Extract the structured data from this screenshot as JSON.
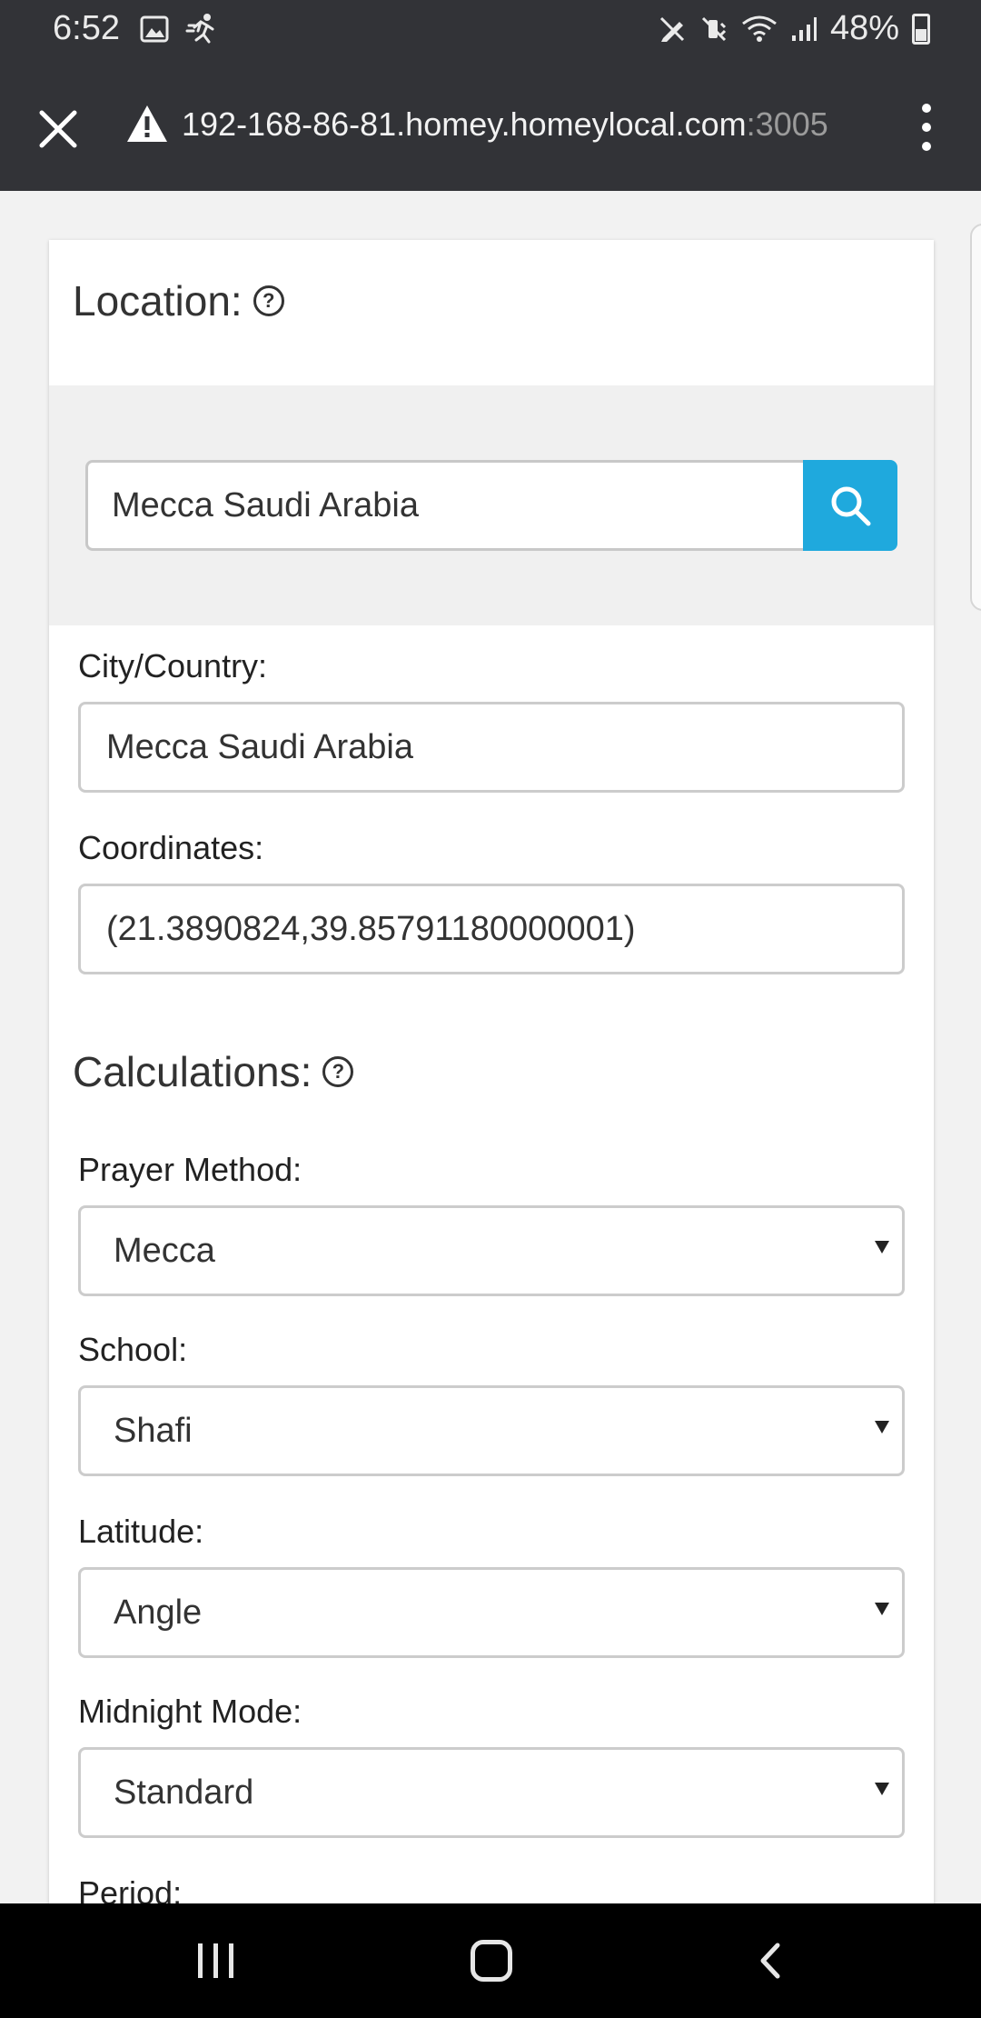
{
  "status_bar": {
    "time": "6:52",
    "battery": "48%",
    "left_icons": [
      "image-icon",
      "running-icon"
    ],
    "right_icons": [
      "pen-off-icon",
      "mute-icon",
      "wifi-icon",
      "signal-icon",
      "battery-icon"
    ]
  },
  "browser": {
    "url_host": "192-168-86-81.homey.homeylocal.com",
    "url_port": ":3005"
  },
  "location": {
    "title": "Location:",
    "search_value": "Mecca Saudi Arabia",
    "city_label": "City/Country:",
    "city_value": "Mecca Saudi Arabia",
    "coords_label": "Coordinates:",
    "coords_value": "(21.3890824,39.85791180000001)"
  },
  "calculations": {
    "title": "Calculations:",
    "prayer_method_label": "Prayer Method:",
    "prayer_method_value": "Mecca",
    "school_label": "School:",
    "school_value": "Shafi",
    "latitude_label": "Latitude:",
    "latitude_value": "Angle",
    "midnight_label": "Midnight Mode:",
    "midnight_value": "Standard",
    "period_label": "Period:"
  },
  "colors": {
    "accent": "#1fa9dd",
    "chrome": "#323337"
  }
}
